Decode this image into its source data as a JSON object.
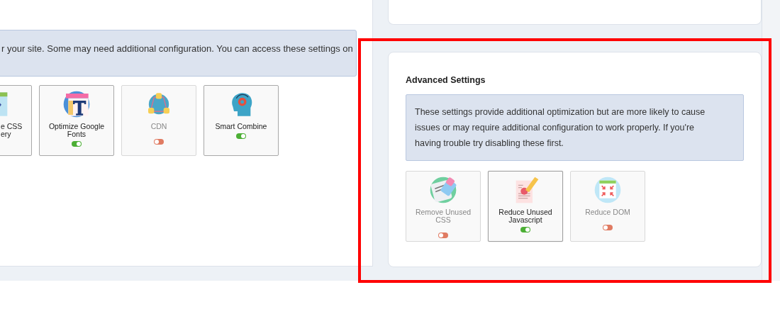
{
  "main_panel": {
    "notice": "r your site. Some may need additional configuration. You can access these settings on",
    "features": [
      {
        "label": "e CSS\nery"
      },
      {
        "label": "Optimize Google Fonts",
        "on": true
      },
      {
        "label": "CDN",
        "on": false
      },
      {
        "label": "Smart Combine",
        "on": true
      }
    ]
  },
  "advanced_settings": {
    "title": "Advanced Settings",
    "notice": "These settings provide additional optimization but are more likely to cause issues or may require additional configuration to work properly. If you're having trouble try disabling these first.",
    "features": [
      {
        "label": "Remove Unused CSS",
        "on": false
      },
      {
        "label": "Reduce Unused Javascript",
        "on": true
      },
      {
        "label": "Reduce DOM",
        "on": false
      }
    ]
  }
}
